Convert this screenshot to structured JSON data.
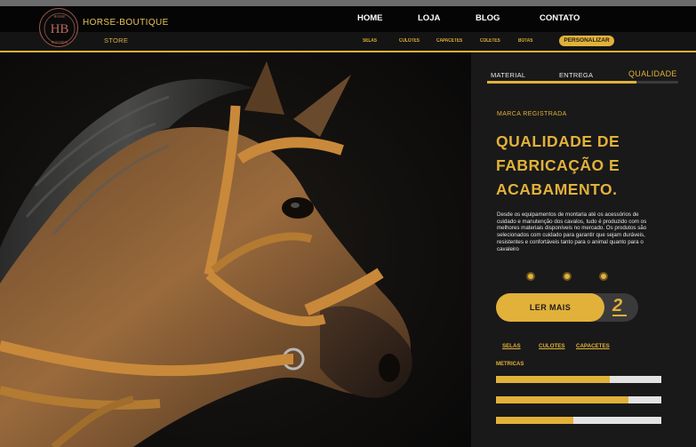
{
  "header": {
    "brand": "HORSE-BOUTIQUE",
    "store": "STORE",
    "nav": [
      "HOME",
      "LOJA",
      "BLOG",
      "CONTATO"
    ],
    "subnav": [
      "SELAS",
      "CULOTES",
      "CAPACETES",
      "COLETES",
      "BOTAS"
    ],
    "customize": "PERSONALIZAR"
  },
  "logo": {
    "monogram": "HB",
    "ring_top": "HORSE",
    "ring_bottom": "BOUTIQUE"
  },
  "tabs": {
    "items": [
      "MATERIAL",
      "ENTREGA",
      "QUALIDADE"
    ],
    "active": "QUALIDADE",
    "progress": 0.78
  },
  "content": {
    "eyebrow": "MARCA REGISTRADA",
    "headline_lines": [
      "QUALIDADE DE",
      "FABRICAÇÃO E",
      "ACABAMENTO."
    ],
    "description": "Desde os equipamentos de montaria até os acessórios de cuidado e manutenção dos cavalos, tudo é produzido com os melhores materiais disponíveis no mercado. Os produtos são selecionados com cuidado para garantir que sejam duráveis, resistentes e confortáveis tanto para o animal quanto para o cavaleiro"
  },
  "carousel_dots": 3,
  "cta": {
    "label": "LER MAIS",
    "number": "2"
  },
  "links": [
    "SELAS",
    "CULOTES",
    "CAPACETES"
  ],
  "metrics": {
    "label": "METRICAS",
    "values": [
      0.69,
      0.8,
      0.47
    ]
  },
  "colors": {
    "accent": "#e2b13a",
    "background": "#191919",
    "header": "#050505"
  }
}
